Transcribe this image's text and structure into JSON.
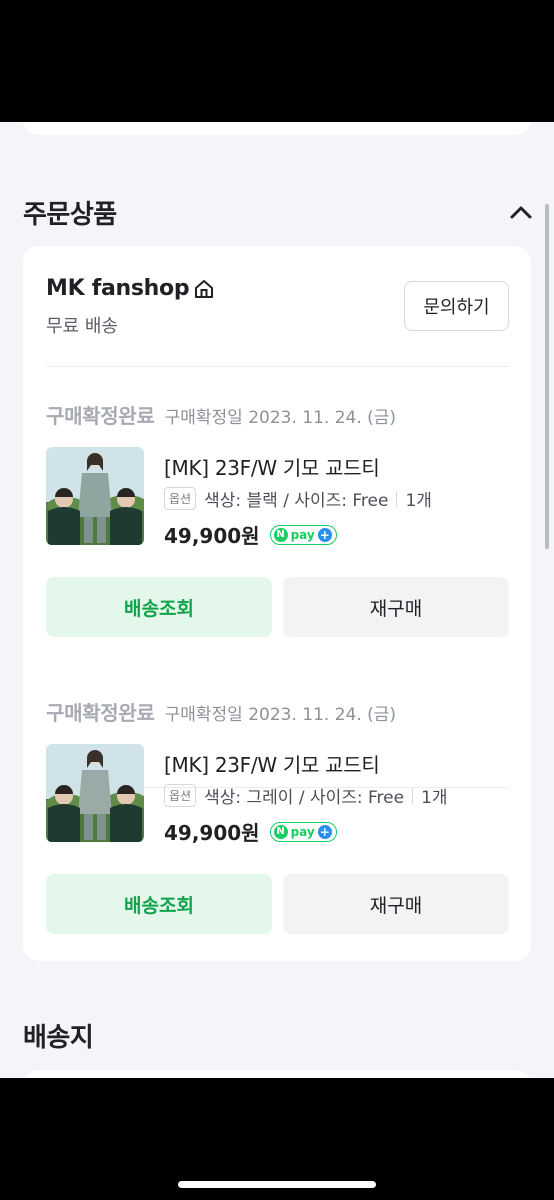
{
  "order_section": {
    "title": "주문상품",
    "shop": {
      "name": "MK fanshop",
      "shipping": "무료 배송",
      "inquiry_label": "문의하기"
    },
    "orders": [
      {
        "status": "구매확정완료",
        "confirm_date": "구매확정일 2023. 11. 24. (금)",
        "product_name": "[MK] 23F/W 기모 교드티",
        "option_tag": "옵션",
        "option_text": "색상: 블랙 / 사이즈: Free",
        "quantity": "1개",
        "price": "49,900원",
        "track_label": "배송조회",
        "rebuy_label": "재구매",
        "hoodie_color": "#8fa6a0"
      },
      {
        "status": "구매확정완료",
        "confirm_date": "구매확정일 2023. 11. 24. (금)",
        "product_name": "[MK] 23F/W 기모 교드티",
        "option_tag": "옵션",
        "option_text": "색상: 그레이 / 사이즈: Free",
        "quantity": "1개",
        "price": "49,900원",
        "track_label": "배송조회",
        "rebuy_label": "재구매",
        "hoodie_color": "#9aaaa6"
      }
    ]
  },
  "npay": {
    "n": "N",
    "pay": "pay",
    "plus": "+"
  },
  "shipping_section": {
    "title": "배송지"
  },
  "colors": {
    "accent_green": "#12a24b",
    "track_bg": "#e3f7ea",
    "npay_green": "#19ce60",
    "npay_blue": "#2a8ef0"
  }
}
